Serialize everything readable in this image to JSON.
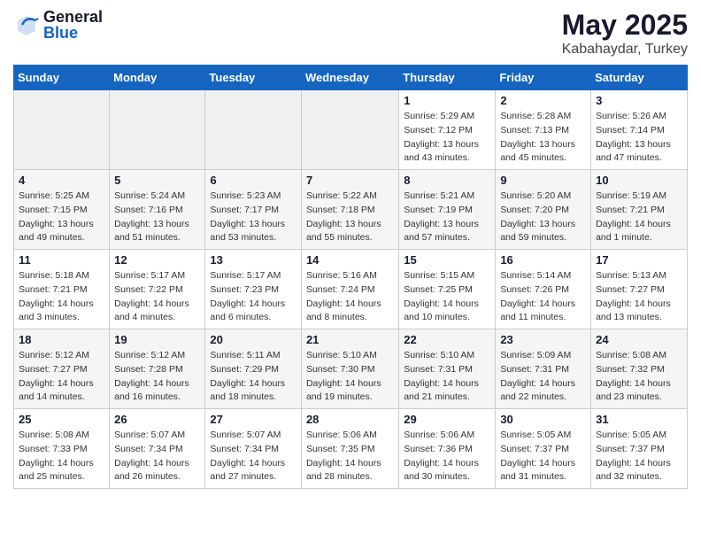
{
  "header": {
    "logo_general": "General",
    "logo_blue": "Blue",
    "month_year": "May 2025",
    "location": "Kabahaydar, Turkey"
  },
  "days_of_week": [
    "Sunday",
    "Monday",
    "Tuesday",
    "Wednesday",
    "Thursday",
    "Friday",
    "Saturday"
  ],
  "weeks": [
    [
      {
        "num": "",
        "info": ""
      },
      {
        "num": "",
        "info": ""
      },
      {
        "num": "",
        "info": ""
      },
      {
        "num": "",
        "info": ""
      },
      {
        "num": "1",
        "info": "Sunrise: 5:29 AM\nSunset: 7:12 PM\nDaylight: 13 hours\nand 43 minutes."
      },
      {
        "num": "2",
        "info": "Sunrise: 5:28 AM\nSunset: 7:13 PM\nDaylight: 13 hours\nand 45 minutes."
      },
      {
        "num": "3",
        "info": "Sunrise: 5:26 AM\nSunset: 7:14 PM\nDaylight: 13 hours\nand 47 minutes."
      }
    ],
    [
      {
        "num": "4",
        "info": "Sunrise: 5:25 AM\nSunset: 7:15 PM\nDaylight: 13 hours\nand 49 minutes."
      },
      {
        "num": "5",
        "info": "Sunrise: 5:24 AM\nSunset: 7:16 PM\nDaylight: 13 hours\nand 51 minutes."
      },
      {
        "num": "6",
        "info": "Sunrise: 5:23 AM\nSunset: 7:17 PM\nDaylight: 13 hours\nand 53 minutes."
      },
      {
        "num": "7",
        "info": "Sunrise: 5:22 AM\nSunset: 7:18 PM\nDaylight: 13 hours\nand 55 minutes."
      },
      {
        "num": "8",
        "info": "Sunrise: 5:21 AM\nSunset: 7:19 PM\nDaylight: 13 hours\nand 57 minutes."
      },
      {
        "num": "9",
        "info": "Sunrise: 5:20 AM\nSunset: 7:20 PM\nDaylight: 13 hours\nand 59 minutes."
      },
      {
        "num": "10",
        "info": "Sunrise: 5:19 AM\nSunset: 7:21 PM\nDaylight: 14 hours\nand 1 minute."
      }
    ],
    [
      {
        "num": "11",
        "info": "Sunrise: 5:18 AM\nSunset: 7:21 PM\nDaylight: 14 hours\nand 3 minutes."
      },
      {
        "num": "12",
        "info": "Sunrise: 5:17 AM\nSunset: 7:22 PM\nDaylight: 14 hours\nand 4 minutes."
      },
      {
        "num": "13",
        "info": "Sunrise: 5:17 AM\nSunset: 7:23 PM\nDaylight: 14 hours\nand 6 minutes."
      },
      {
        "num": "14",
        "info": "Sunrise: 5:16 AM\nSunset: 7:24 PM\nDaylight: 14 hours\nand 8 minutes."
      },
      {
        "num": "15",
        "info": "Sunrise: 5:15 AM\nSunset: 7:25 PM\nDaylight: 14 hours\nand 10 minutes."
      },
      {
        "num": "16",
        "info": "Sunrise: 5:14 AM\nSunset: 7:26 PM\nDaylight: 14 hours\nand 11 minutes."
      },
      {
        "num": "17",
        "info": "Sunrise: 5:13 AM\nSunset: 7:27 PM\nDaylight: 14 hours\nand 13 minutes."
      }
    ],
    [
      {
        "num": "18",
        "info": "Sunrise: 5:12 AM\nSunset: 7:27 PM\nDaylight: 14 hours\nand 14 minutes."
      },
      {
        "num": "19",
        "info": "Sunrise: 5:12 AM\nSunset: 7:28 PM\nDaylight: 14 hours\nand 16 minutes."
      },
      {
        "num": "20",
        "info": "Sunrise: 5:11 AM\nSunset: 7:29 PM\nDaylight: 14 hours\nand 18 minutes."
      },
      {
        "num": "21",
        "info": "Sunrise: 5:10 AM\nSunset: 7:30 PM\nDaylight: 14 hours\nand 19 minutes."
      },
      {
        "num": "22",
        "info": "Sunrise: 5:10 AM\nSunset: 7:31 PM\nDaylight: 14 hours\nand 21 minutes."
      },
      {
        "num": "23",
        "info": "Sunrise: 5:09 AM\nSunset: 7:31 PM\nDaylight: 14 hours\nand 22 minutes."
      },
      {
        "num": "24",
        "info": "Sunrise: 5:08 AM\nSunset: 7:32 PM\nDaylight: 14 hours\nand 23 minutes."
      }
    ],
    [
      {
        "num": "25",
        "info": "Sunrise: 5:08 AM\nSunset: 7:33 PM\nDaylight: 14 hours\nand 25 minutes."
      },
      {
        "num": "26",
        "info": "Sunrise: 5:07 AM\nSunset: 7:34 PM\nDaylight: 14 hours\nand 26 minutes."
      },
      {
        "num": "27",
        "info": "Sunrise: 5:07 AM\nSunset: 7:34 PM\nDaylight: 14 hours\nand 27 minutes."
      },
      {
        "num": "28",
        "info": "Sunrise: 5:06 AM\nSunset: 7:35 PM\nDaylight: 14 hours\nand 28 minutes."
      },
      {
        "num": "29",
        "info": "Sunrise: 5:06 AM\nSunset: 7:36 PM\nDaylight: 14 hours\nand 30 minutes."
      },
      {
        "num": "30",
        "info": "Sunrise: 5:05 AM\nSunset: 7:37 PM\nDaylight: 14 hours\nand 31 minutes."
      },
      {
        "num": "31",
        "info": "Sunrise: 5:05 AM\nSunset: 7:37 PM\nDaylight: 14 hours\nand 32 minutes."
      }
    ]
  ]
}
